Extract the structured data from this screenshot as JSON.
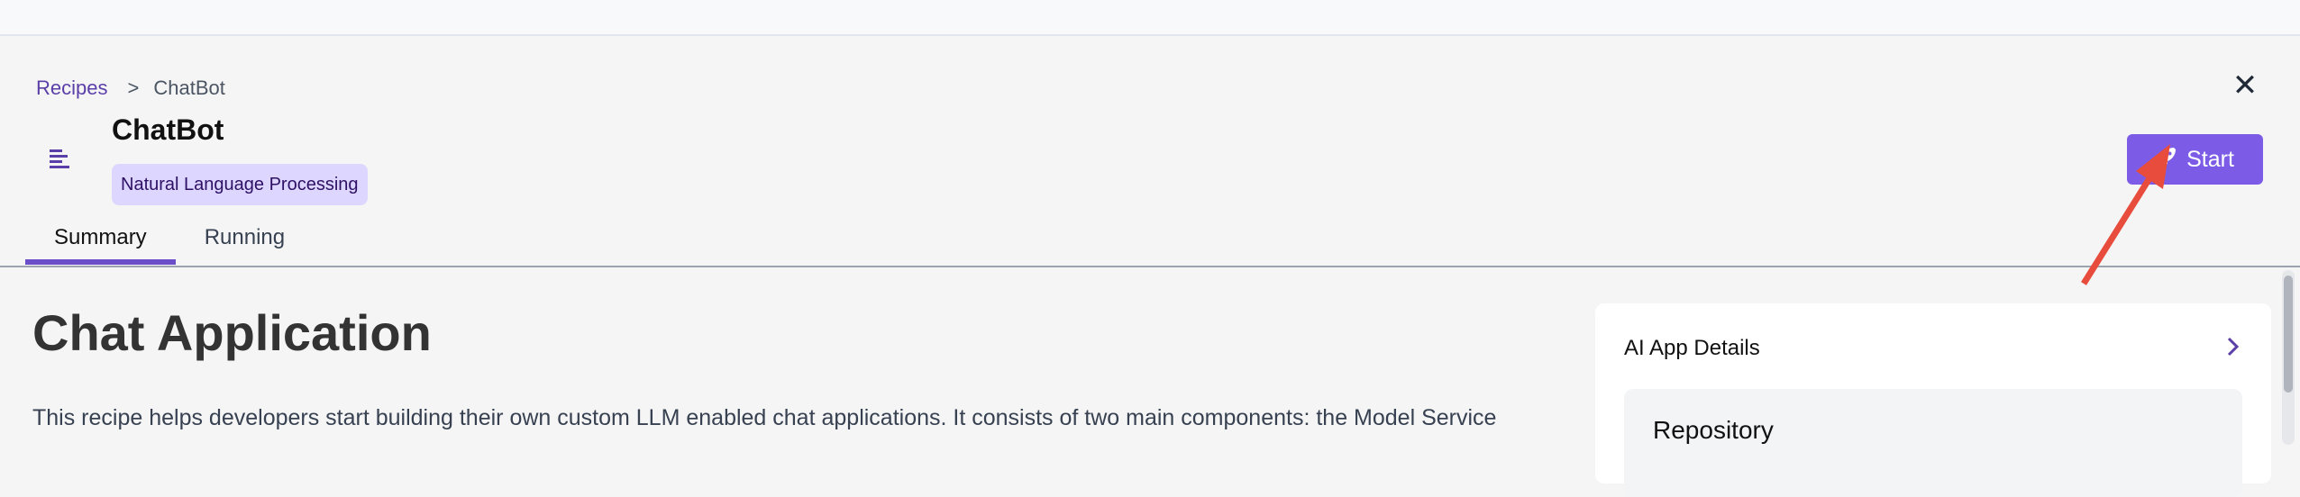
{
  "breadcrumb": {
    "parent": "Recipes",
    "separator": ">",
    "current": "ChatBot"
  },
  "header": {
    "title": "ChatBot",
    "tag": "Natural Language Processing",
    "start_label": "Start",
    "close_icon": "close-icon",
    "list_icon": "list-icon"
  },
  "tabs": [
    {
      "label": "Summary",
      "active": true
    },
    {
      "label": "Running",
      "active": false
    }
  ],
  "main": {
    "heading": "Chat Application",
    "paragraph": "This recipe helps developers start building their own custom LLM enabled chat applications. It consists of two main components: the Model Service"
  },
  "side_card": {
    "title": "AI App Details",
    "section": "Repository"
  },
  "colors": {
    "accent": "#7c5ce6",
    "tag_bg": "#ddd6fe",
    "annotation_arrow": "#e74c3c"
  }
}
